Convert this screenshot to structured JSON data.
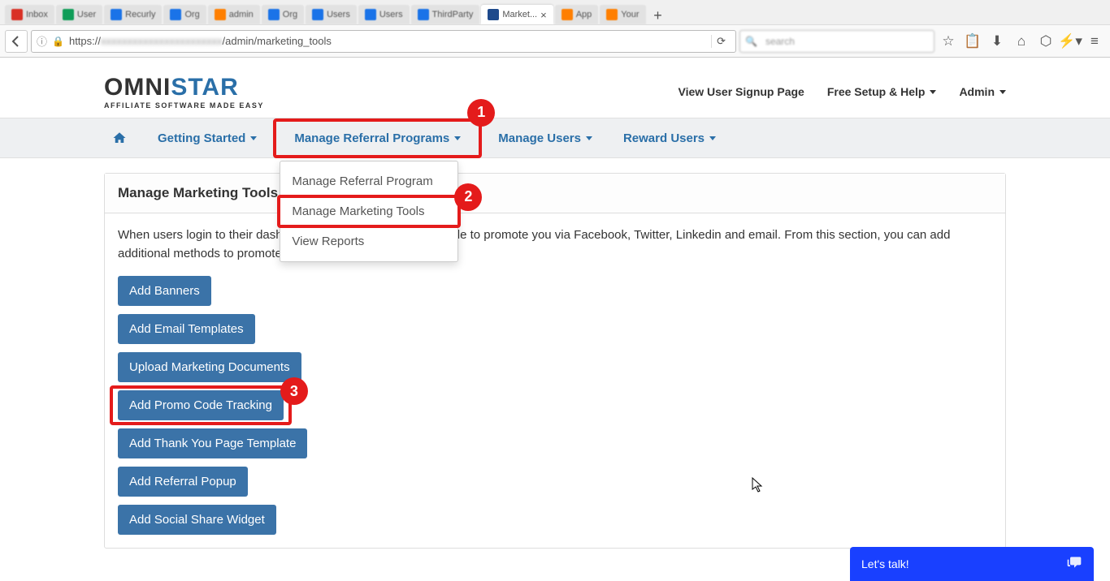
{
  "browser": {
    "tabs": [
      {
        "label": "Inbox",
        "favicon": "red"
      },
      {
        "label": "User",
        "favicon": "green"
      },
      {
        "label": "Recurly",
        "favicon": "blue"
      },
      {
        "label": "Org",
        "favicon": "blue"
      },
      {
        "label": "admin",
        "favicon": "orange"
      },
      {
        "label": "Org",
        "favicon": "blue"
      },
      {
        "label": "Users",
        "favicon": "blue"
      },
      {
        "label": "Users",
        "favicon": "blue"
      },
      {
        "label": "ThirdParty",
        "favicon": "blue"
      },
      {
        "label": "Market...",
        "favicon": "bluedark",
        "active": true
      },
      {
        "label": "App",
        "favicon": "orange"
      },
      {
        "label": "Your",
        "favicon": "orange"
      }
    ],
    "url_prefix": "https://",
    "url_path": "/admin/marketing_tools"
  },
  "header": {
    "logo_main_a": "OMNI",
    "logo_main_b": "STAR",
    "logo_sub": "AFFILIATE SOFTWARE MADE EASY",
    "links": {
      "signup": "View User Signup Page",
      "setup": "Free Setup & Help",
      "admin": "Admin"
    }
  },
  "nav": {
    "getting_started": "Getting Started",
    "manage_referral": "Manage Referral Programs",
    "manage_users": "Manage Users",
    "reward_users": "Reward Users"
  },
  "dropdown": {
    "items": [
      "Manage Referral Program",
      "Manage Marketing Tools",
      "View Reports"
    ]
  },
  "panel": {
    "title": "Manage Marketing Tools",
    "desc": "When users login to their dashboard, by default, they will be able to promote you via Facebook, Twitter, Linkedin and email. From this section, you can add additional methods to promote you."
  },
  "buttons": [
    "Add Banners",
    "Add Email Templates",
    "Upload Marketing Documents",
    "Add Promo Code Tracking",
    "Add Thank You Page Template",
    "Add Referral Popup",
    "Add Social Share Widget"
  ],
  "annotations": {
    "a1": "1",
    "a2": "2",
    "a3": "3"
  },
  "chat": {
    "label": "Let's talk!"
  }
}
